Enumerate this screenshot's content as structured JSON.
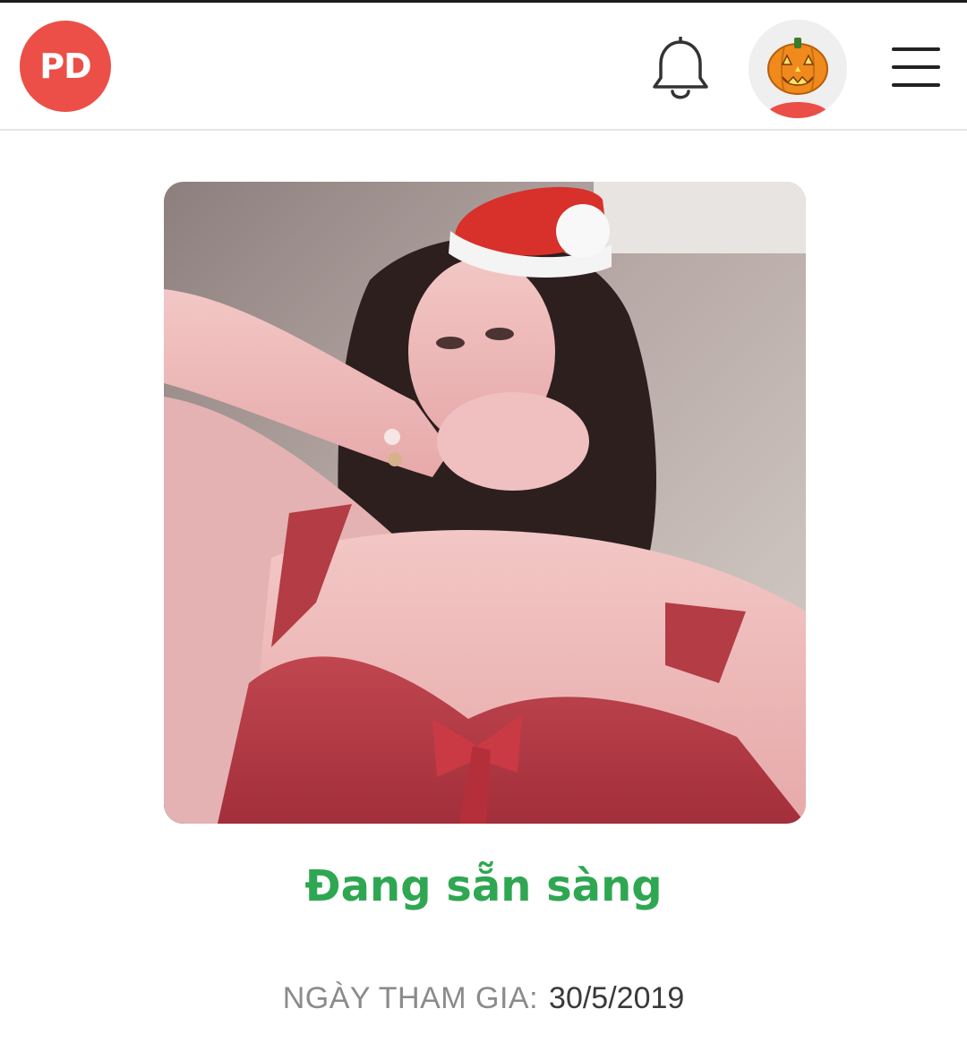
{
  "header": {
    "logo_text": "PD",
    "logo_color": "#ec4f47",
    "icons": [
      "bell-icon",
      "pumpkin-avatar-icon",
      "hamburger-menu-icon"
    ]
  },
  "profile": {
    "photo_description": "profile-photo",
    "status": "Đang sẵn sàng",
    "status_color": "#2fa752",
    "joined_label": "NGÀY THAM GIA:",
    "joined_date": "30/5/2019"
  }
}
